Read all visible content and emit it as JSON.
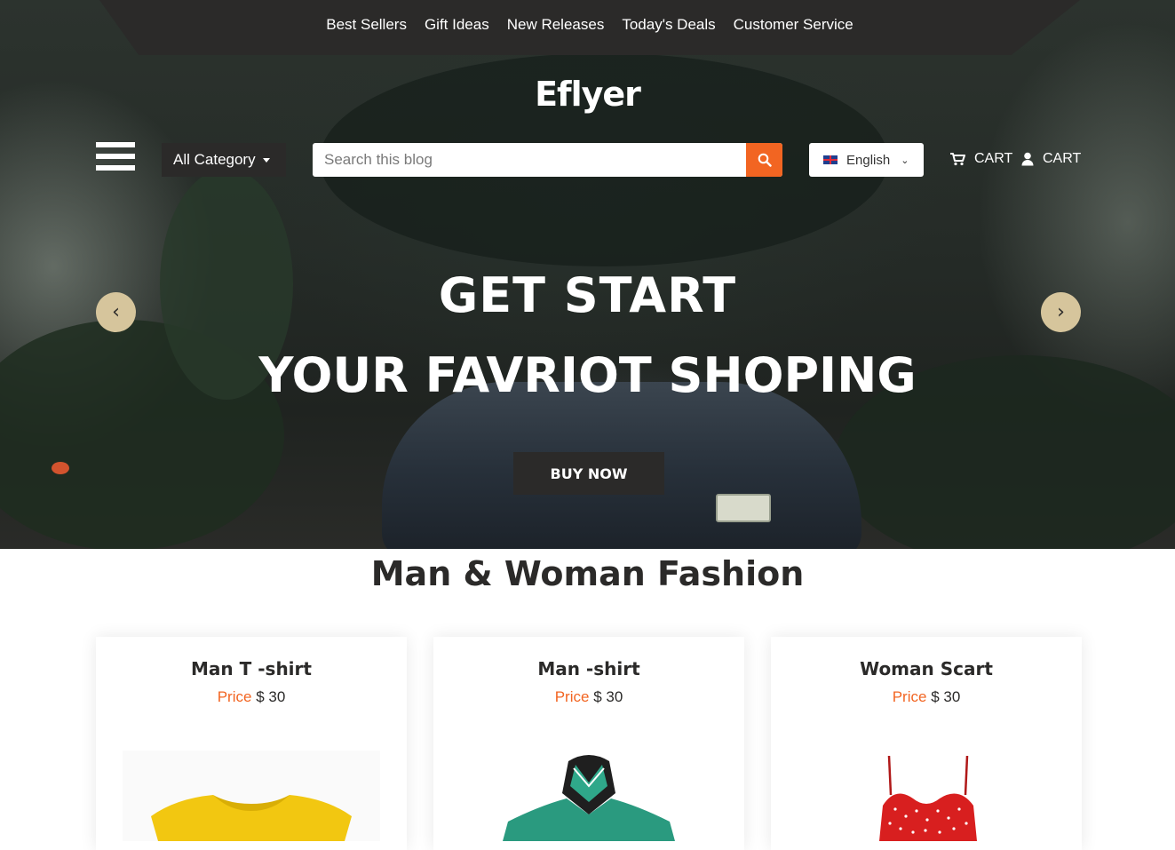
{
  "nav": {
    "items": [
      "Best Sellers",
      "Gift Ideas",
      "New Releases",
      "Today's Deals",
      "Customer Service"
    ]
  },
  "logo": "Eflyer",
  "header": {
    "category_label": "All Category",
    "search_placeholder": "Search this blog",
    "language": "English",
    "cart_label": "CART",
    "account_label": "CART"
  },
  "hero": {
    "headline_1": "GET START",
    "headline_2": "YOUR FAVRIOT SHOPING",
    "cta": "BUY NOW"
  },
  "section": {
    "title": "Man & Woman Fashion"
  },
  "products": [
    {
      "name": "Man T -shirt",
      "price_label": "Price",
      "price_value": "$ 30"
    },
    {
      "name": "Man -shirt",
      "price_label": "Price",
      "price_value": "$ 30"
    },
    {
      "name": "Woman Scart",
      "price_label": "Price",
      "price_value": "$ 30"
    }
  ],
  "colors": {
    "dark": "#2b2a29",
    "accent": "#f26522",
    "slider_arrow": "#d6c59c"
  },
  "icons": [
    "hamburger-icon",
    "search-icon",
    "flag-uk-icon",
    "chevron-down-icon",
    "cart-icon",
    "user-icon",
    "arrow-left-icon",
    "arrow-right-icon"
  ]
}
